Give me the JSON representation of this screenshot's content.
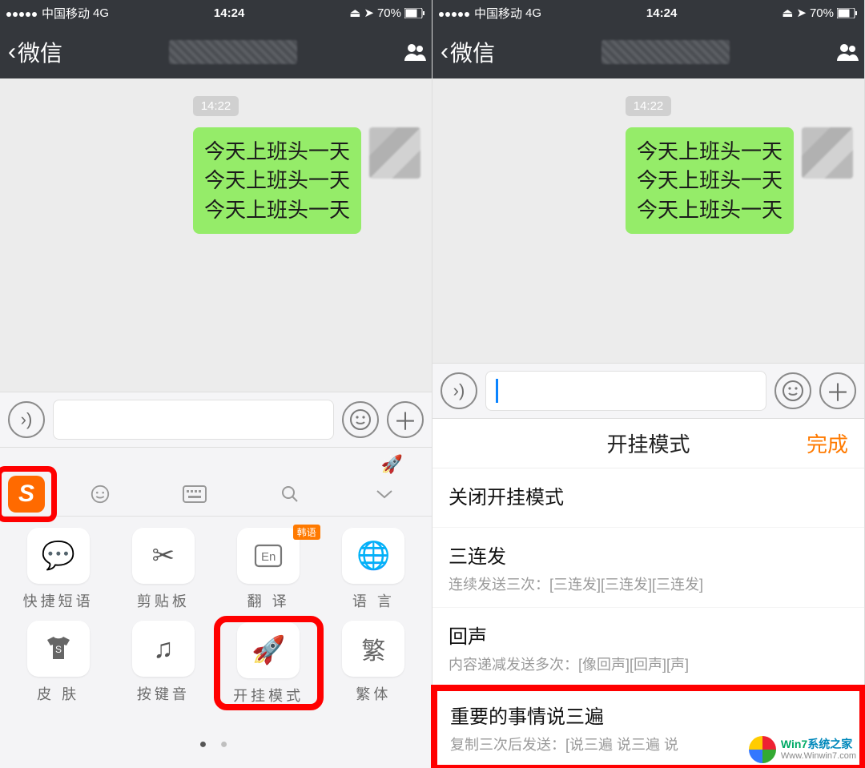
{
  "status": {
    "carrier": "中国移动",
    "net": "4G",
    "time": "14:24",
    "battery": "70%"
  },
  "nav": {
    "back": "微信"
  },
  "chat": {
    "timestamp": "14:22",
    "msg_line1": "今天上班头一天",
    "msg_line2": "今天上班头一天",
    "msg_line3": "今天上班头一天"
  },
  "keyboard": {
    "items": {
      "0": {
        "label": "快捷短语"
      },
      "1": {
        "label": "剪贴板"
      },
      "2": {
        "label": "翻 译",
        "badge": "韩语"
      },
      "3": {
        "label": "语 言"
      },
      "4": {
        "label": "皮 肤"
      },
      "5": {
        "label": "按键音"
      },
      "6": {
        "label": "开挂模式"
      },
      "7": {
        "label": "繁体"
      }
    }
  },
  "mode": {
    "title": "开挂模式",
    "done": "完成",
    "items": {
      "0": {
        "title": "关闭开挂模式"
      },
      "1": {
        "title": "三连发",
        "sub": "连续发送三次：[三连发][三连发][三连发]"
      },
      "2": {
        "title": "回声",
        "sub": "内容递减发送多次：[像回声][回声][声]"
      },
      "3": {
        "title": "重要的事情说三遍",
        "sub": "复制三次后发送：[说三遍 说三遍 说"
      }
    }
  },
  "wm": {
    "t1": "Win7",
    "t2": "系统之家",
    "sub": "Www.Winwin7.com"
  }
}
